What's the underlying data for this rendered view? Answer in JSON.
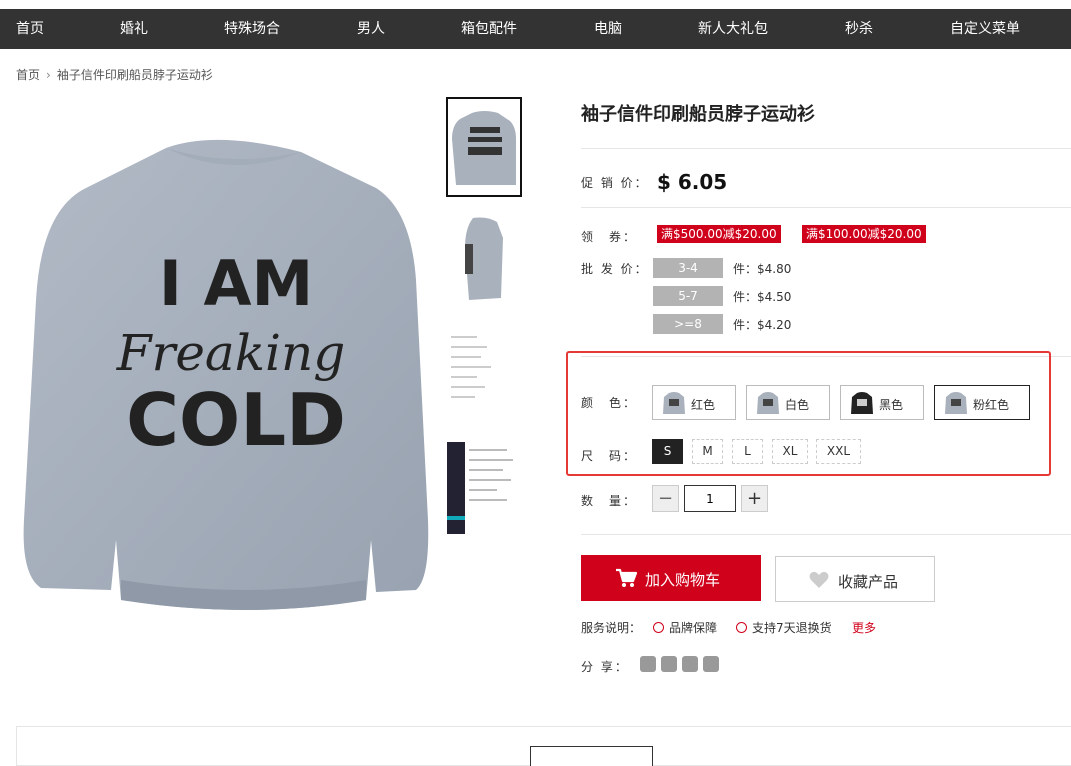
{
  "nav": {
    "items": [
      "首页",
      "婚礼",
      "特殊场合",
      "男人",
      "箱包配件",
      "电脑",
      "新人大礼包",
      "秒杀",
      "自定义菜单"
    ]
  },
  "breadcrumb": {
    "home": "首页",
    "separator": "›",
    "current": "袖子信件印刷船员脖子运动衫"
  },
  "product": {
    "title": "袖子信件印刷船员脖子运动衫",
    "image_text": [
      "I AM",
      "Freaking",
      "COLD"
    ],
    "promo_label": "促 销 价：",
    "price": "$ 6.05",
    "coupon_label": "领　券：",
    "coupons": [
      "满$500.00减$20.00",
      "满$100.00减$20.00"
    ],
    "wholesale_label": "批 发 价：",
    "wholesale": [
      {
        "range": "3-4",
        "price": "件：$4.80"
      },
      {
        "range": "5-7",
        "price": "件：$4.50"
      },
      {
        "range": ">=8",
        "price": "件：$4.20"
      }
    ],
    "color_label": "颜　色：",
    "colors": [
      "红色",
      "白色",
      "黑色",
      "粉红色"
    ],
    "selected_color": "粉红色",
    "size_label": "尺　码：",
    "sizes": [
      "S",
      "M",
      "L",
      "XL",
      "XXL"
    ],
    "selected_size": "S",
    "qty_label": "数　量：",
    "qty": "1",
    "qty_minus": "−",
    "qty_plus": "+",
    "add_to_cart": "加入购物车",
    "favorite": "收藏产品",
    "service_label": "服务说明：",
    "services": [
      "品牌保障",
      "支持7天退换货"
    ],
    "service_more": "更多",
    "share_label": "分 享：",
    "share_icons": [
      "weibo-icon",
      "wechat-icon",
      "qzone-icon",
      "qq-icon"
    ]
  },
  "colors": {
    "accent": "#d0021b",
    "nav_bg": "#333333",
    "highlight_border": "#e53935"
  }
}
